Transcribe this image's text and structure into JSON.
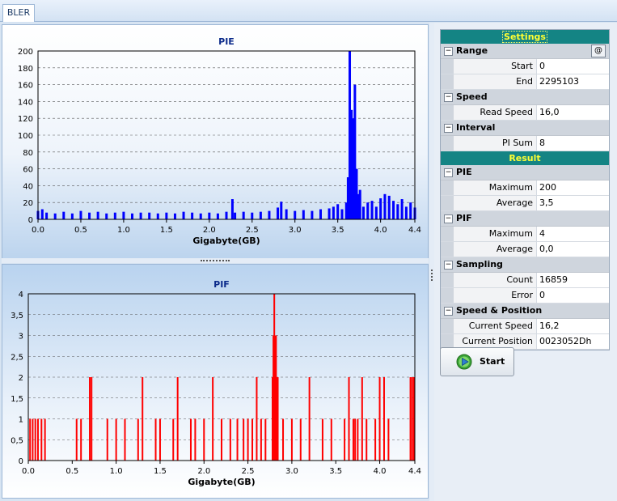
{
  "tabs": [
    {
      "label": "BLER"
    }
  ],
  "charts": {
    "pie": {
      "title": "PIE",
      "xlabel": "Gigabyte(GB)",
      "x_ticks": [
        "0.0",
        "0.5",
        "1.0",
        "1.5",
        "2.0",
        "2.5",
        "3.0",
        "3.5",
        "4.0",
        "4.4"
      ],
      "y_ticks": [
        "0",
        "20",
        "40",
        "60",
        "80",
        "100",
        "120",
        "140",
        "160",
        "180",
        "200"
      ],
      "color": "#0000ff"
    },
    "pif": {
      "title": "PIF",
      "xlabel": "Gigabyte(GB)",
      "x_ticks": [
        "0.0",
        "0.5",
        "1.0",
        "1.5",
        "2.0",
        "2.5",
        "3.0",
        "3.5",
        "4.0",
        "4.4"
      ],
      "y_ticks": [
        "0",
        "0,5",
        "1",
        "1,5",
        "2",
        "2,5",
        "3",
        "3,5",
        "4"
      ],
      "color": "#ff0000"
    }
  },
  "chart_data": [
    {
      "type": "bar",
      "title": "PIE",
      "xlabel": "Gigabyte(GB)",
      "ylabel": "",
      "xlim": [
        0,
        4.4
      ],
      "ylim": [
        0,
        200
      ],
      "grid": true,
      "x": [
        0.0,
        0.05,
        0.1,
        0.2,
        0.3,
        0.4,
        0.5,
        0.6,
        0.7,
        0.8,
        0.9,
        1.0,
        1.1,
        1.2,
        1.3,
        1.4,
        1.5,
        1.6,
        1.7,
        1.8,
        1.9,
        2.0,
        2.1,
        2.2,
        2.27,
        2.3,
        2.4,
        2.5,
        2.6,
        2.7,
        2.8,
        2.84,
        2.9,
        3.0,
        3.1,
        3.2,
        3.3,
        3.4,
        3.45,
        3.5,
        3.55,
        3.6,
        3.62,
        3.64,
        3.66,
        3.68,
        3.7,
        3.72,
        3.74,
        3.76,
        3.8,
        3.85,
        3.9,
        3.95,
        4.0,
        4.05,
        4.1,
        4.15,
        4.2,
        4.25,
        4.3,
        4.35,
        4.4
      ],
      "values": [
        10,
        12,
        8,
        7,
        9,
        7,
        10,
        8,
        9,
        7,
        8,
        9,
        7,
        8,
        8,
        7,
        8,
        7,
        9,
        8,
        7,
        8,
        7,
        9,
        24,
        8,
        9,
        8,
        9,
        10,
        14,
        21,
        12,
        10,
        11,
        10,
        12,
        13,
        15,
        18,
        12,
        20,
        50,
        200,
        130,
        120,
        160,
        60,
        30,
        35,
        15,
        20,
        22,
        15,
        25,
        30,
        28,
        22,
        18,
        24,
        15,
        20,
        14
      ]
    },
    {
      "type": "bar",
      "title": "PIF",
      "xlabel": "Gigabyte(GB)",
      "ylabel": "",
      "xlim": [
        0,
        4.4
      ],
      "ylim": [
        0,
        4
      ],
      "grid": true,
      "x": [
        0.02,
        0.05,
        0.08,
        0.11,
        0.15,
        0.19,
        0.55,
        0.6,
        0.7,
        0.72,
        0.9,
        1.0,
        1.1,
        1.25,
        1.3,
        1.45,
        1.5,
        1.65,
        1.7,
        1.85,
        1.9,
        2.0,
        2.1,
        2.2,
        2.3,
        2.38,
        2.45,
        2.5,
        2.55,
        2.6,
        2.65,
        2.7,
        2.78,
        2.79,
        2.8,
        2.81,
        2.82,
        2.83,
        2.84,
        2.9,
        3.0,
        3.1,
        3.2,
        3.35,
        3.45,
        3.6,
        3.65,
        3.7,
        3.72,
        3.75,
        3.8,
        3.85,
        3.95,
        4.0,
        4.05,
        4.1,
        4.35,
        4.37,
        4.39
      ],
      "values": [
        1,
        1,
        1,
        1,
        1,
        1,
        1,
        1,
        2,
        2,
        1,
        1,
        1,
        1,
        2,
        1,
        1,
        1,
        2,
        1,
        1,
        1,
        2,
        1,
        1,
        1,
        1,
        1,
        1,
        2,
        1,
        1,
        2,
        3,
        4,
        3,
        3,
        2,
        2,
        1,
        1,
        1,
        2,
        1,
        1,
        1,
        2,
        1,
        1,
        1,
        2,
        1,
        1,
        2,
        2,
        1,
        2,
        2,
        2
      ]
    }
  ],
  "props": {
    "settings_title": "Settings",
    "result_title": "Result",
    "range": {
      "label": "Range",
      "toggle": "−",
      "at": "@",
      "start_label": "Start",
      "start": "0",
      "end_label": "End",
      "end": "2295103"
    },
    "speed": {
      "label": "Speed",
      "toggle": "−",
      "read_speed_label": "Read Speed",
      "read_speed": "16,0"
    },
    "interval": {
      "label": "Interval",
      "toggle": "−",
      "pi_sum_label": "PI Sum",
      "pi_sum": "8"
    },
    "pie": {
      "label": "PIE",
      "toggle": "−",
      "max_label": "Maximum",
      "max": "200",
      "avg_label": "Average",
      "avg": "3,5"
    },
    "pif": {
      "label": "PIF",
      "toggle": "−",
      "max_label": "Maximum",
      "max": "4",
      "avg_label": "Average",
      "avg": "0,0"
    },
    "sampling": {
      "label": "Sampling",
      "toggle": "−",
      "count_label": "Count",
      "count": "16859",
      "error_label": "Error",
      "error": "0"
    },
    "speed_pos": {
      "label": "Speed & Position",
      "toggle": "−",
      "cur_speed_label": "Current Speed",
      "cur_speed": "16,2",
      "cur_pos_label": "Current Position",
      "cur_pos": "0023052Dh"
    }
  },
  "start_button": {
    "label": "Start",
    "icon": "play-icon"
  }
}
